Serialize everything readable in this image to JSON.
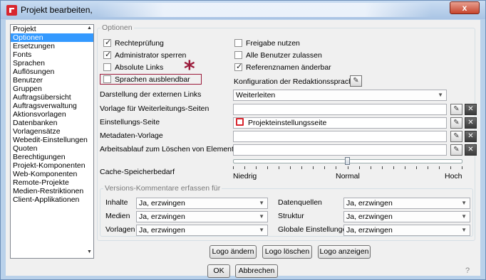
{
  "window": {
    "title": "Projekt bearbeiten,",
    "close_glyph": "x"
  },
  "sidebar": {
    "items": [
      {
        "label": "Projekt",
        "selected": false
      },
      {
        "label": "Optionen",
        "selected": true
      },
      {
        "label": "Ersetzungen",
        "selected": false
      },
      {
        "label": "Fonts",
        "selected": false
      },
      {
        "label": "Sprachen",
        "selected": false
      },
      {
        "label": "Auflösungen",
        "selected": false
      },
      {
        "label": "Benutzer",
        "selected": false
      },
      {
        "label": "Gruppen",
        "selected": false
      },
      {
        "label": "Auftragsübersicht",
        "selected": false
      },
      {
        "label": "Auftragsverwaltung",
        "selected": false
      },
      {
        "label": "Aktionsvorlagen",
        "selected": false
      },
      {
        "label": "Datenbanken",
        "selected": false
      },
      {
        "label": "Vorlagensätze",
        "selected": false
      },
      {
        "label": "Webedit-Einstellungen",
        "selected": false
      },
      {
        "label": "Quoten",
        "selected": false
      },
      {
        "label": "Berechtigungen",
        "selected": false
      },
      {
        "label": "Projekt-Komponenten",
        "selected": false
      },
      {
        "label": "Web-Komponenten",
        "selected": false
      },
      {
        "label": "Remote-Projekte",
        "selected": false
      },
      {
        "label": "Medien-Restriktionen",
        "selected": false
      },
      {
        "label": "Client-Applikationen",
        "selected": false
      }
    ]
  },
  "options": {
    "group_label": "Optionen",
    "checkboxes": {
      "rechtepruefung": {
        "label": "Rechteprüfung",
        "checked": true
      },
      "admin_sperren": {
        "label": "Administrator sperren",
        "checked": true
      },
      "absolute_links": {
        "label": "Absolute Links",
        "checked": false
      },
      "sprachen_ausblendbar": {
        "label": "Sprachen ausblendbar",
        "checked": false
      },
      "freigabe_nutzen": {
        "label": "Freigabe nutzen",
        "checked": false
      },
      "alle_benutzer_zulassen": {
        "label": "Alle Benutzer zulassen",
        "checked": false
      },
      "referenznamen_aenderbar": {
        "label": "Referenznamen änderbar",
        "checked": true
      }
    },
    "star": "*",
    "konfig_label": "Konfiguration der Redaktionssprachen",
    "fields": {
      "darstellung_label": "Darstellung der externen Links",
      "darstellung_value": "Weiterleiten",
      "vorlage_label": "Vorlage für Weiterleitungs-Seiten",
      "vorlage_value": "",
      "einstellungs_label": "Einstellungs-Seite",
      "einstellungs_value": "Projekteinstellungsseite",
      "metadaten_label": "Metadaten-Vorlage",
      "metadaten_value": "",
      "arbeitsablauf_label": "Arbeitsablauf zum Löschen von Elementen",
      "arbeitsablauf_value": ""
    },
    "cache": {
      "label": "Cache-Speicherbedarf",
      "low": "Niedrig",
      "mid": "Normal",
      "high": "Hoch",
      "level_fraction": 0.5
    },
    "versions": {
      "group_label": "Versions-Kommentare erfassen für",
      "left": [
        {
          "label": "Inhalte",
          "value": "Ja, erzwingen"
        },
        {
          "label": "Medien",
          "value": "Ja, erzwingen"
        },
        {
          "label": "Vorlagen",
          "value": "Ja, erzwingen"
        }
      ],
      "right": [
        {
          "label": "Datenquellen",
          "value": "Ja, erzwingen"
        },
        {
          "label": "Struktur",
          "value": "Ja, erzwingen"
        },
        {
          "label": "Globale Einstellungen",
          "value": "Ja, erzwingen"
        }
      ]
    },
    "logo_buttons": {
      "change": "Logo ändern",
      "delete": "Logo löschen",
      "show": "Logo anzeigen"
    }
  },
  "footer": {
    "ok": "OK",
    "cancel": "Abbrechen",
    "help": "?"
  },
  "colors": {
    "highlight": "#9b1b3b",
    "selection": "#3399ff"
  }
}
